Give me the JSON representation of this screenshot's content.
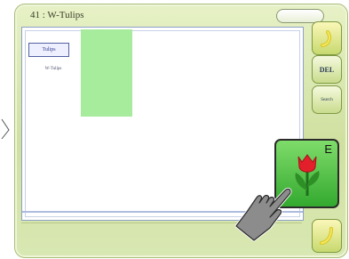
{
  "header": {
    "title": "41 : W-Tulips",
    "status_text": "",
    "pill_label": ""
  },
  "left_info": {
    "tag": "Tulips",
    "line1": "",
    "line2": "W-Tulips",
    "line3": "",
    "line4": "",
    "line5": ""
  },
  "side_buttons": {
    "del": "DEL",
    "search": "Search"
  },
  "feature_button": {
    "label": "E"
  }
}
